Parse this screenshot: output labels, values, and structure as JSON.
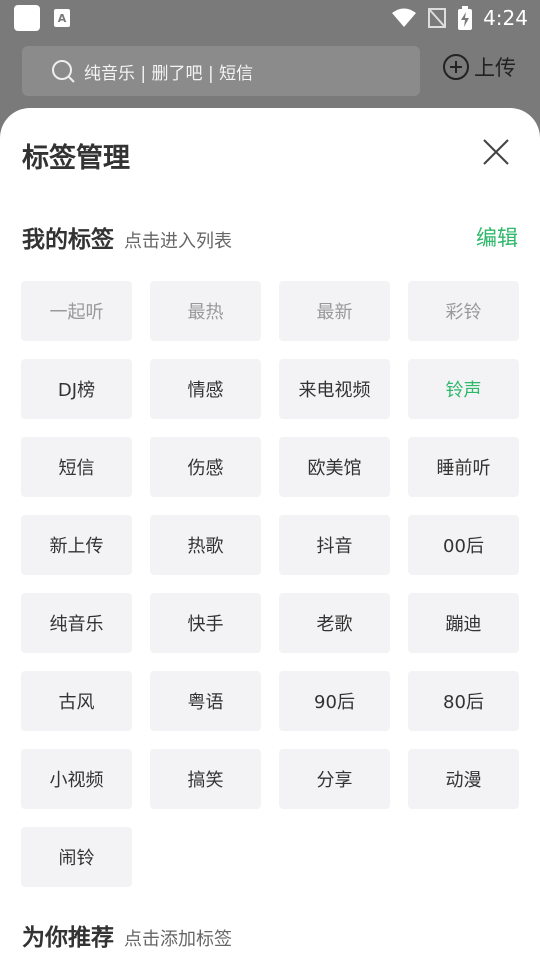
{
  "status_bar": {
    "time": "4:24",
    "small_icon_letter": "A"
  },
  "search": {
    "placeholder": "纯音乐 | 删了吧 | 短信"
  },
  "upload": {
    "label": "上传"
  },
  "sheet": {
    "title": "标签管理"
  },
  "my_tags": {
    "title": "我的标签",
    "subtitle": "点击进入列表",
    "edit_label": "编辑",
    "items": [
      {
        "label": "一起听",
        "state": "fixed"
      },
      {
        "label": "最热",
        "state": "fixed"
      },
      {
        "label": "最新",
        "state": "fixed"
      },
      {
        "label": "彩铃",
        "state": "fixed"
      },
      {
        "label": "DJ榜",
        "state": "normal"
      },
      {
        "label": "情感",
        "state": "normal"
      },
      {
        "label": "来电视频",
        "state": "normal"
      },
      {
        "label": "铃声",
        "state": "active"
      },
      {
        "label": "短信",
        "state": "normal"
      },
      {
        "label": "伤感",
        "state": "normal"
      },
      {
        "label": "欧美馆",
        "state": "normal"
      },
      {
        "label": "睡前听",
        "state": "normal"
      },
      {
        "label": "新上传",
        "state": "normal"
      },
      {
        "label": "热歌",
        "state": "normal"
      },
      {
        "label": "抖音",
        "state": "normal"
      },
      {
        "label": "00后",
        "state": "normal"
      },
      {
        "label": "纯音乐",
        "state": "normal"
      },
      {
        "label": "快手",
        "state": "normal"
      },
      {
        "label": "老歌",
        "state": "normal"
      },
      {
        "label": "蹦迪",
        "state": "normal"
      },
      {
        "label": "古风",
        "state": "normal"
      },
      {
        "label": "粤语",
        "state": "normal"
      },
      {
        "label": "90后",
        "state": "normal"
      },
      {
        "label": "80后",
        "state": "normal"
      },
      {
        "label": "小视频",
        "state": "normal"
      },
      {
        "label": "搞笑",
        "state": "normal"
      },
      {
        "label": "分享",
        "state": "normal"
      },
      {
        "label": "动漫",
        "state": "normal"
      },
      {
        "label": "闹铃",
        "state": "normal"
      }
    ]
  },
  "recommend": {
    "title": "为你推荐",
    "subtitle": "点击添加标签"
  },
  "colors": {
    "accent": "#2db86a",
    "tag_bg": "#f3f3f5",
    "overlay": "#7a7a7a"
  }
}
